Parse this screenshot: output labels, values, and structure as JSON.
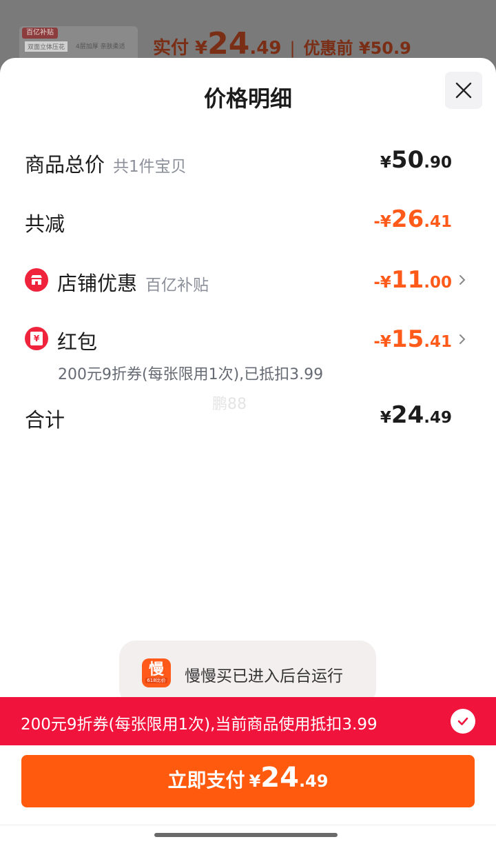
{
  "background": {
    "thumb_tag": "百亿补贴",
    "thumb_text1": "双面立体压花",
    "thumb_text2": "4层加厚 亲肤柔适",
    "pay_label": "实付 ¥",
    "pay_int": "24",
    "pay_dec": ".49",
    "sep": "|",
    "pre_label": "优惠前 ¥50.9"
  },
  "sheet": {
    "title": "价格明细",
    "total": {
      "label": "商品总价",
      "sub": "共1件宝贝",
      "sym": "¥",
      "int": "50",
      "dec": ".90"
    },
    "reduce": {
      "label": "共减",
      "sym": "-¥",
      "int": "26",
      "dec": ".41"
    },
    "shop": {
      "label": "店铺优惠",
      "sub": "百亿补贴",
      "sym": "-¥",
      "int": "11",
      "dec": ".00"
    },
    "redpacket": {
      "label": "红包",
      "sym": "-¥",
      "int": "15",
      "dec": ".41",
      "note": "200元9折券(每张限用1次),已抵扣3.99",
      "icon_char": "¥"
    },
    "watermark": "鹏88",
    "sum": {
      "label": "合计",
      "sym": "¥",
      "int": "24",
      "dec": ".49"
    }
  },
  "toast": {
    "app_char": "慢",
    "app_sub": "618比价",
    "message": "慢慢买已进入后台运行"
  },
  "banner": {
    "text": "200元9折券(每张限用1次),当前商品使用抵扣3.99"
  },
  "pay_button": {
    "label": "立即支付",
    "sym": "¥",
    "int": "24",
    "dec": ".49"
  },
  "colors": {
    "accent": "#ff5a1a",
    "banner": "#f0143c",
    "button": "#ff5a0d"
  }
}
